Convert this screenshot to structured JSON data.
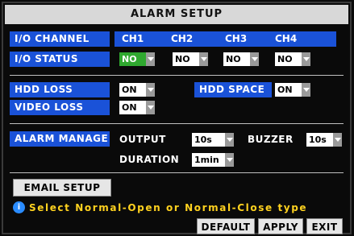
{
  "window": {
    "title": "ALARM SETUP"
  },
  "io": {
    "channel_label": "I/O CHANNEL",
    "status_label": "I/O STATUS",
    "channels": [
      "CH1",
      "CH2",
      "CH3",
      "CH4"
    ],
    "statuses": [
      "NO",
      "NO",
      "NO",
      "NO"
    ]
  },
  "loss": {
    "hdd_loss_label": "HDD LOSS",
    "hdd_loss_value": "ON",
    "hdd_space_label": "HDD SPACE",
    "hdd_space_value": "ON",
    "video_loss_label": "VIDEO LOSS",
    "video_loss_value": "ON"
  },
  "alarm_manage": {
    "label": "ALARM MANAGE",
    "output_label": "OUTPUT",
    "output_value": "10s",
    "buzzer_label": "BUZZER",
    "buzzer_value": "10s",
    "duration_label": "DURATION",
    "duration_value": "1min"
  },
  "email_button": "EMAIL SETUP",
  "hint": "Select Normal-Open or Normal-Close type",
  "buttons": {
    "default": "DEFAULT",
    "apply": "APPLY",
    "exit": "EXIT"
  },
  "colors": {
    "label_blue": "#1a52d8",
    "selected_green": "#2fa82f",
    "hint_yellow": "#ffd21f"
  },
  "icons": {
    "hint_icon": "info-bubble-icon"
  }
}
